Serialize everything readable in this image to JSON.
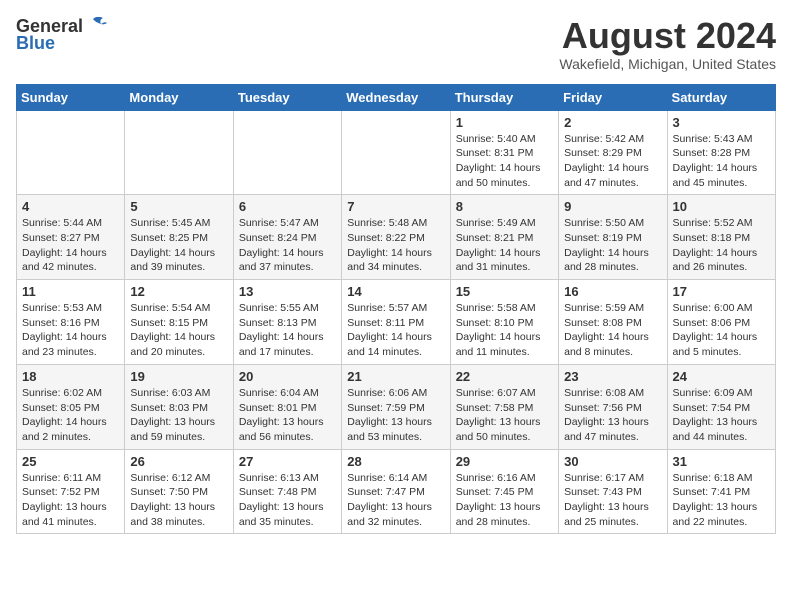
{
  "logo": {
    "general": "General",
    "blue": "Blue"
  },
  "title": "August 2024",
  "location": "Wakefield, Michigan, United States",
  "days_of_week": [
    "Sunday",
    "Monday",
    "Tuesday",
    "Wednesday",
    "Thursday",
    "Friday",
    "Saturday"
  ],
  "weeks": [
    [
      {
        "day": "",
        "info": ""
      },
      {
        "day": "",
        "info": ""
      },
      {
        "day": "",
        "info": ""
      },
      {
        "day": "",
        "info": ""
      },
      {
        "day": "1",
        "info": "Sunrise: 5:40 AM\nSunset: 8:31 PM\nDaylight: 14 hours\nand 50 minutes."
      },
      {
        "day": "2",
        "info": "Sunrise: 5:42 AM\nSunset: 8:29 PM\nDaylight: 14 hours\nand 47 minutes."
      },
      {
        "day": "3",
        "info": "Sunrise: 5:43 AM\nSunset: 8:28 PM\nDaylight: 14 hours\nand 45 minutes."
      }
    ],
    [
      {
        "day": "4",
        "info": "Sunrise: 5:44 AM\nSunset: 8:27 PM\nDaylight: 14 hours\nand 42 minutes."
      },
      {
        "day": "5",
        "info": "Sunrise: 5:45 AM\nSunset: 8:25 PM\nDaylight: 14 hours\nand 39 minutes."
      },
      {
        "day": "6",
        "info": "Sunrise: 5:47 AM\nSunset: 8:24 PM\nDaylight: 14 hours\nand 37 minutes."
      },
      {
        "day": "7",
        "info": "Sunrise: 5:48 AM\nSunset: 8:22 PM\nDaylight: 14 hours\nand 34 minutes."
      },
      {
        "day": "8",
        "info": "Sunrise: 5:49 AM\nSunset: 8:21 PM\nDaylight: 14 hours\nand 31 minutes."
      },
      {
        "day": "9",
        "info": "Sunrise: 5:50 AM\nSunset: 8:19 PM\nDaylight: 14 hours\nand 28 minutes."
      },
      {
        "day": "10",
        "info": "Sunrise: 5:52 AM\nSunset: 8:18 PM\nDaylight: 14 hours\nand 26 minutes."
      }
    ],
    [
      {
        "day": "11",
        "info": "Sunrise: 5:53 AM\nSunset: 8:16 PM\nDaylight: 14 hours\nand 23 minutes."
      },
      {
        "day": "12",
        "info": "Sunrise: 5:54 AM\nSunset: 8:15 PM\nDaylight: 14 hours\nand 20 minutes."
      },
      {
        "day": "13",
        "info": "Sunrise: 5:55 AM\nSunset: 8:13 PM\nDaylight: 14 hours\nand 17 minutes."
      },
      {
        "day": "14",
        "info": "Sunrise: 5:57 AM\nSunset: 8:11 PM\nDaylight: 14 hours\nand 14 minutes."
      },
      {
        "day": "15",
        "info": "Sunrise: 5:58 AM\nSunset: 8:10 PM\nDaylight: 14 hours\nand 11 minutes."
      },
      {
        "day": "16",
        "info": "Sunrise: 5:59 AM\nSunset: 8:08 PM\nDaylight: 14 hours\nand 8 minutes."
      },
      {
        "day": "17",
        "info": "Sunrise: 6:00 AM\nSunset: 8:06 PM\nDaylight: 14 hours\nand 5 minutes."
      }
    ],
    [
      {
        "day": "18",
        "info": "Sunrise: 6:02 AM\nSunset: 8:05 PM\nDaylight: 14 hours\nand 2 minutes."
      },
      {
        "day": "19",
        "info": "Sunrise: 6:03 AM\nSunset: 8:03 PM\nDaylight: 13 hours\nand 59 minutes."
      },
      {
        "day": "20",
        "info": "Sunrise: 6:04 AM\nSunset: 8:01 PM\nDaylight: 13 hours\nand 56 minutes."
      },
      {
        "day": "21",
        "info": "Sunrise: 6:06 AM\nSunset: 7:59 PM\nDaylight: 13 hours\nand 53 minutes."
      },
      {
        "day": "22",
        "info": "Sunrise: 6:07 AM\nSunset: 7:58 PM\nDaylight: 13 hours\nand 50 minutes."
      },
      {
        "day": "23",
        "info": "Sunrise: 6:08 AM\nSunset: 7:56 PM\nDaylight: 13 hours\nand 47 minutes."
      },
      {
        "day": "24",
        "info": "Sunrise: 6:09 AM\nSunset: 7:54 PM\nDaylight: 13 hours\nand 44 minutes."
      }
    ],
    [
      {
        "day": "25",
        "info": "Sunrise: 6:11 AM\nSunset: 7:52 PM\nDaylight: 13 hours\nand 41 minutes."
      },
      {
        "day": "26",
        "info": "Sunrise: 6:12 AM\nSunset: 7:50 PM\nDaylight: 13 hours\nand 38 minutes."
      },
      {
        "day": "27",
        "info": "Sunrise: 6:13 AM\nSunset: 7:48 PM\nDaylight: 13 hours\nand 35 minutes."
      },
      {
        "day": "28",
        "info": "Sunrise: 6:14 AM\nSunset: 7:47 PM\nDaylight: 13 hours\nand 32 minutes."
      },
      {
        "day": "29",
        "info": "Sunrise: 6:16 AM\nSunset: 7:45 PM\nDaylight: 13 hours\nand 28 minutes."
      },
      {
        "day": "30",
        "info": "Sunrise: 6:17 AM\nSunset: 7:43 PM\nDaylight: 13 hours\nand 25 minutes."
      },
      {
        "day": "31",
        "info": "Sunrise: 6:18 AM\nSunset: 7:41 PM\nDaylight: 13 hours\nand 22 minutes."
      }
    ]
  ]
}
